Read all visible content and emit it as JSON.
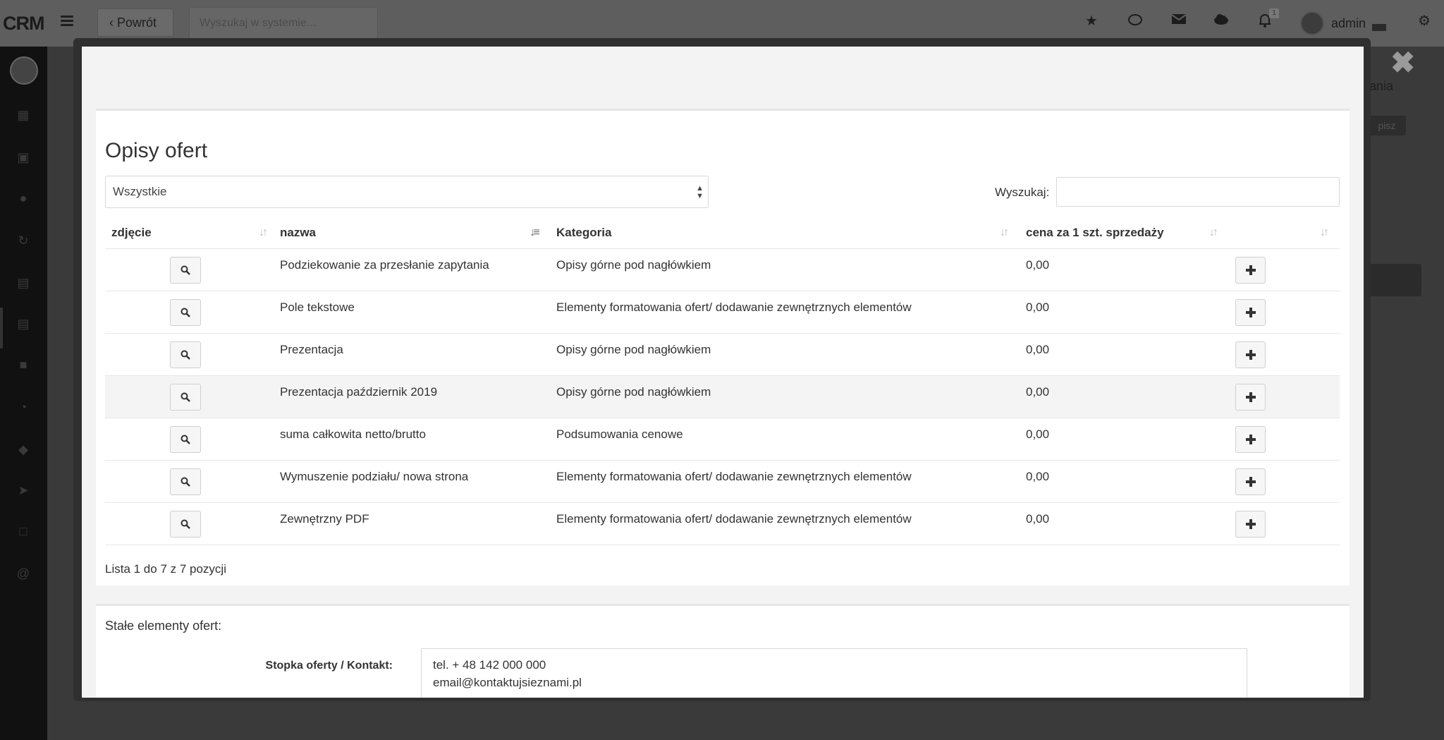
{
  "app": {
    "brand": "CRM",
    "back_label": "Powrót",
    "search_placeholder": "Wyszukaj w systemie...",
    "user_name": "admin",
    "notification_count": "1",
    "bg_right_text": "dania",
    "bg_right_button": "pisz",
    "bg_close": "✖"
  },
  "modal": {
    "title": "Opisy ofert",
    "filter": {
      "selected": "Wszystkie"
    },
    "search_label": "Wyszukaj:",
    "search_value": "",
    "columns": {
      "photo": "zdjęcie",
      "name": "nazwa",
      "category": "Kategoria",
      "price": "cena za 1 szt. sprzedaży"
    },
    "rows": [
      {
        "name": "Podziekowanie za przesłanie zapytania",
        "category": "Opisy górne pod nagłówkiem",
        "price": "0,00"
      },
      {
        "name": "Pole tekstowe",
        "category": "Elementy formatowania ofert/ dodawanie zewnętrznych elementów",
        "price": "0,00"
      },
      {
        "name": "Prezentacja",
        "category": "Opisy górne pod nagłówkiem",
        "price": "0,00"
      },
      {
        "name": "Prezentacja październik 2019",
        "category": "Opisy górne pod nagłówkiem",
        "price": "0,00"
      },
      {
        "name": "suma całkowita netto/brutto",
        "category": "Podsumowania cenowe",
        "price": "0,00"
      },
      {
        "name": "Wymuszenie podziału/ nowa strona",
        "category": "Elementy formatowania ofert/ dodawanie zewnętrznych elementów",
        "price": "0,00"
      },
      {
        "name": "Zewnętrzny PDF",
        "category": "Elementy formatowania ofert/ dodawanie zewnętrznych elementów",
        "price": "0,00"
      }
    ],
    "list_info": "Lista 1 do 7 z 7 pozycji",
    "fixed_section": {
      "title": "Stałe elementy ofert:",
      "footer_label": "Stopka oferty / Kontakt:",
      "footer_lines": [
        "tel. + 48 142 000 000",
        "email@kontaktujsieznami.pl"
      ]
    }
  }
}
